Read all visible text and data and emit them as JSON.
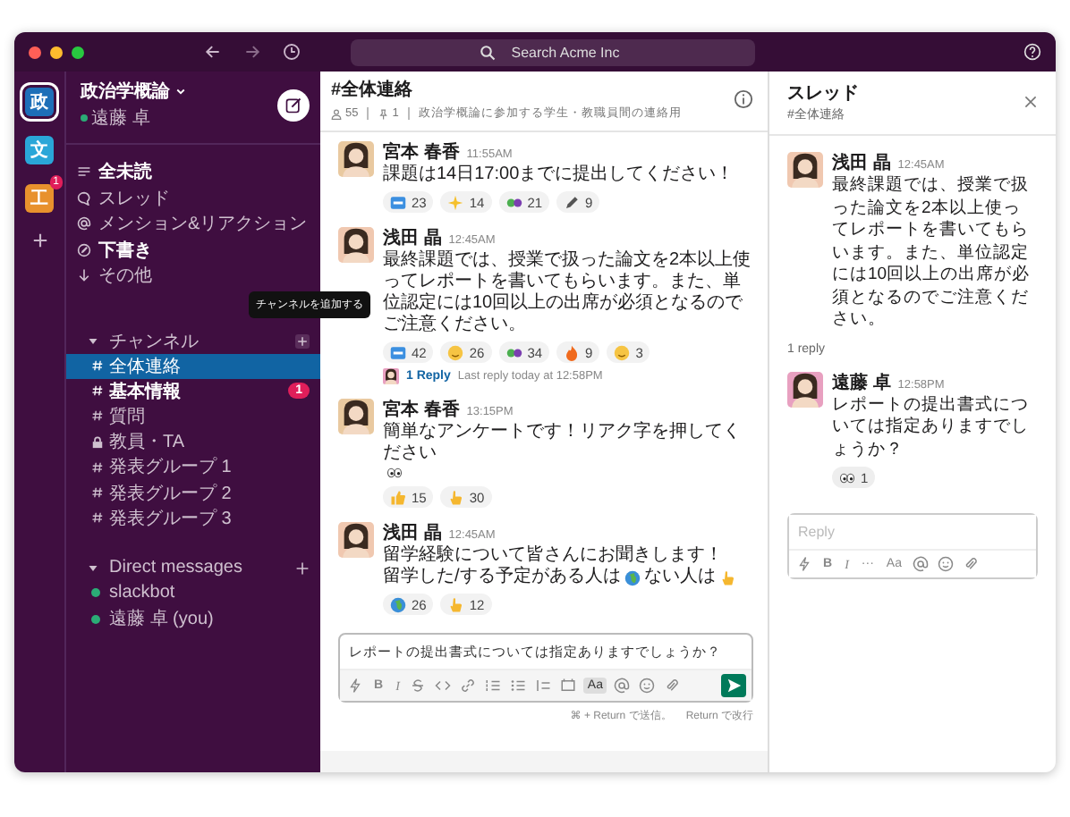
{
  "window": {
    "search_placeholder": "Search Acme Inc"
  },
  "workspaces": [
    {
      "label": "政",
      "color": "#1d6fb8",
      "selected": true
    },
    {
      "label": "文",
      "color": "#2aa6d8",
      "selected": false
    },
    {
      "label": "工",
      "color": "#e8912d",
      "selected": false,
      "badge": "1"
    }
  ],
  "sidebar": {
    "workspace_name": "政治学概論",
    "user": "遠藤 卓",
    "nav": [
      {
        "label": "全未読",
        "kind": "unreads",
        "bold": true
      },
      {
        "label": "スレッド",
        "kind": "threads",
        "bold": false
      },
      {
        "label": "メンション&リアクション",
        "kind": "mentions",
        "bold": false
      },
      {
        "label": "下書き",
        "kind": "drafts",
        "bold": true
      },
      {
        "label": "その他",
        "kind": "more",
        "bold": false
      }
    ],
    "channels": {
      "title": "チャンネル",
      "expanded": true,
      "tooltip": "チャンネルを追加する",
      "items": [
        {
          "label": "全体連絡",
          "kind": "public",
          "selected": true,
          "bold": false
        },
        {
          "label": "基本情報",
          "kind": "public",
          "selected": false,
          "bold": true,
          "badge": "1"
        },
        {
          "label": "質問",
          "kind": "public",
          "selected": false,
          "bold": false
        },
        {
          "label": "教員・TA",
          "kind": "private",
          "selected": false,
          "bold": false
        },
        {
          "label": "発表グループ 1",
          "kind": "public",
          "selected": false,
          "bold": false
        },
        {
          "label": "発表グループ 2",
          "kind": "public",
          "selected": false,
          "bold": false
        },
        {
          "label": "発表グループ 3",
          "kind": "public",
          "selected": false,
          "bold": false
        }
      ]
    },
    "dms": {
      "title": "Direct messages",
      "expanded": true,
      "items": [
        {
          "label": "slackbot",
          "color": "#2bac76",
          "selected": false
        },
        {
          "label": "遠藤 卓 (you)",
          "color": "#2bac76",
          "selected": false
        }
      ]
    }
  },
  "main": {
    "channel": "#全体連絡",
    "members": "55",
    "pins": "1",
    "topic": "政治学概論に参加する学生・教職員間の連絡用",
    "messages": [
      {
        "author": "宮本 春香",
        "time": "11:55AM",
        "color": "#e9c9a0",
        "lines": [
          [
            {
              "kind": "text",
              "text": "課題は14日17:00までに提出してください！"
            }
          ]
        ],
        "reactions": [
          {
            "kind": "ok",
            "count": "23"
          },
          {
            "kind": "sparkle",
            "count": "14"
          },
          {
            "kind": "people",
            "count": "21"
          },
          {
            "kind": "pencil",
            "count": "9"
          }
        ]
      },
      {
        "author": "浅田 晶",
        "time": "12:45AM",
        "color": "#f0c8b0",
        "lines": [
          [
            {
              "kind": "text",
              "text": "最終課題では、授業で扱った論文を2本以上使ってレポートを書いてもらいます。また、単位認定には10回以上の出席が必須となるのでご注意ください。"
            }
          ]
        ],
        "reactions": [
          {
            "kind": "ok",
            "count": "42"
          },
          {
            "kind": "smile",
            "count": "26"
          },
          {
            "kind": "people",
            "count": "34"
          },
          {
            "kind": "fire",
            "count": "9"
          },
          {
            "kind": "smile",
            "count": "3"
          }
        ],
        "thread": {
          "color": "#e8a0c0",
          "replies": "1 Reply",
          "last": "Last reply today at 12:58PM"
        }
      },
      {
        "author": "宮本 春香",
        "time": "13:15PM",
        "color": "#e9c9a0",
        "lines": [
          [
            {
              "kind": "text",
              "text": "簡単なアンケートです！リアク字を押してください"
            },
            {
              "kind": "eyes"
            }
          ]
        ],
        "reactions": [
          {
            "kind": "thumb",
            "count": "15"
          },
          {
            "kind": "point",
            "count": "30"
          }
        ]
      },
      {
        "author": "浅田 晶",
        "time": "12:45AM",
        "color": "#f0c8b0",
        "lines": [
          [
            {
              "kind": "text",
              "text": "留学経験について皆さんにお聞きします！"
            }
          ],
          [
            {
              "kind": "text",
              "text": "留学した/する予定がある人は"
            },
            {
              "kind": "globe"
            },
            {
              "kind": "text",
              "text": "ない人は"
            },
            {
              "kind": "point"
            }
          ]
        ],
        "reactions": [
          {
            "kind": "globe",
            "count": "26"
          },
          {
            "kind": "point",
            "count": "12"
          }
        ]
      }
    ],
    "composer": {
      "value": "レポートの提出書式については指定ありますでしょうか？",
      "tools": [
        {
          "kind": "bolt"
        },
        {
          "kind": "text",
          "text": "B",
          "bold": true,
          "italic": false,
          "selected": false
        },
        {
          "kind": "text",
          "text": "I",
          "bold": false,
          "italic": true,
          "selected": false
        },
        {
          "kind": "strike"
        },
        {
          "kind": "code"
        },
        {
          "kind": "link"
        },
        {
          "kind": "ol"
        },
        {
          "kind": "ul"
        },
        {
          "kind": "quote"
        },
        {
          "kind": "codeblock"
        },
        {
          "kind": "text",
          "text": "Aa",
          "bold": false,
          "italic": false,
          "selected": true
        },
        {
          "kind": "at"
        },
        {
          "kind": "emoji"
        },
        {
          "kind": "clip"
        },
        {
          "kind": "send"
        }
      ],
      "hints": [
        "⌘ + Return で送信。",
        "Return で改行"
      ]
    }
  },
  "thread": {
    "title": "スレッド",
    "channel": "#全体連絡",
    "parent": {
      "author": "浅田 晶",
      "time": "12:45AM",
      "color": "#f0c8b0",
      "text": "最終課題では、授業で扱った論文を2本以上使ってレポートを書いてもらいます。また、単位認定には10回以上の出席が必須となるのでご注意ください。"
    },
    "reply_count": "1 reply",
    "replies": [
      {
        "author": "遠藤 卓",
        "time": "12:58PM",
        "color": "#e8a0c0",
        "text": "レポートの提出書式については指定ありますでしょうか？",
        "reactions": [
          {
            "kind": "eyes",
            "count": "1"
          }
        ]
      }
    ],
    "reply_box": {
      "placeholder": "Reply",
      "tools": [
        {
          "kind": "bolt"
        },
        {
          "kind": "text",
          "text": "B",
          "bold": true,
          "italic": false,
          "selected": false
        },
        {
          "kind": "text",
          "text": "I",
          "bold": false,
          "italic": true,
          "selected": false
        },
        {
          "kind": "text",
          "text": "···",
          "bold": false,
          "italic": false,
          "selected": false
        },
        {
          "kind": "text",
          "text": "Aa",
          "bold": false,
          "italic": false,
          "selected": false
        },
        {
          "kind": "at"
        },
        {
          "kind": "emoji"
        },
        {
          "kind": "clip"
        }
      ]
    }
  }
}
